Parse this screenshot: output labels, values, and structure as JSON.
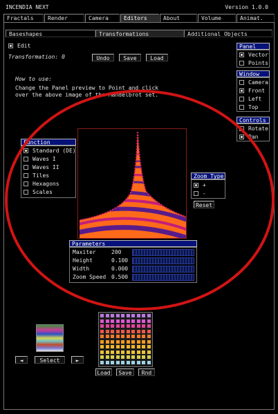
{
  "app": {
    "title": "INCENDIA NEXT",
    "version": "Version 1.0.0"
  },
  "menu_tabs": [
    "Fractals",
    "Render",
    "Camera",
    "Editors",
    "About",
    "Volume",
    "Animat."
  ],
  "sub_tabs": [
    "Baseshapes",
    "Transformations",
    "Additional Objects"
  ],
  "edit_label": "Edit",
  "transformation_label": "Transformation: 0",
  "buttons": {
    "undo": "Undo",
    "save": "Save",
    "load": "Load"
  },
  "howto": {
    "title": "How to use:",
    "line1": "Change the Panel preview  to Point and click",
    "line2": "over the above image of the Mandelbrot  set."
  },
  "panel": {
    "title": "Panel",
    "items": [
      {
        "label": "Vector",
        "checked": true
      },
      {
        "label": "Points",
        "checked": false
      }
    ]
  },
  "window": {
    "title": "Window",
    "items": [
      {
        "label": "Camera",
        "checked": false
      },
      {
        "label": "Front",
        "checked": true
      },
      {
        "label": "Left",
        "checked": false
      },
      {
        "label": "Top",
        "checked": false
      }
    ]
  },
  "controls": {
    "title": "Controls",
    "items": [
      {
        "label": "Rotate",
        "checked": false
      },
      {
        "label": "Pan",
        "checked": true
      }
    ]
  },
  "function": {
    "title": "Function",
    "items": [
      {
        "label": "Standard (DE)",
        "checked": true
      },
      {
        "label": "Waves I",
        "checked": false
      },
      {
        "label": "Waves II",
        "checked": false
      },
      {
        "label": "Tiles",
        "checked": false
      },
      {
        "label": "Hexagons",
        "checked": false
      },
      {
        "label": "Scales",
        "checked": false
      }
    ]
  },
  "zoom_type": {
    "title": "Zoom Type",
    "items": [
      {
        "label": "+",
        "checked": true
      },
      {
        "label": "-",
        "checked": false
      }
    ],
    "reset": "Reset"
  },
  "parameters": {
    "title": "Parameters",
    "rows": [
      {
        "label": "Maxiter",
        "value": "200"
      },
      {
        "label": "Height",
        "value": "0.100"
      },
      {
        "label": "Width",
        "value": "0.000"
      },
      {
        "label": "Zoom Speed",
        "value": "0.500"
      }
    ]
  },
  "palette": {
    "select": "Select",
    "prev_arrow": "◄",
    "next_arrow": "►"
  },
  "gradient_buttons": {
    "load": "Load",
    "save": "Save",
    "rnd": "Rnd"
  },
  "colors": {
    "accent": "#06127a",
    "circle": "#d11414",
    "fractal_orange": "#ff6a1a",
    "fractal_purple": "#5a1b8a"
  }
}
